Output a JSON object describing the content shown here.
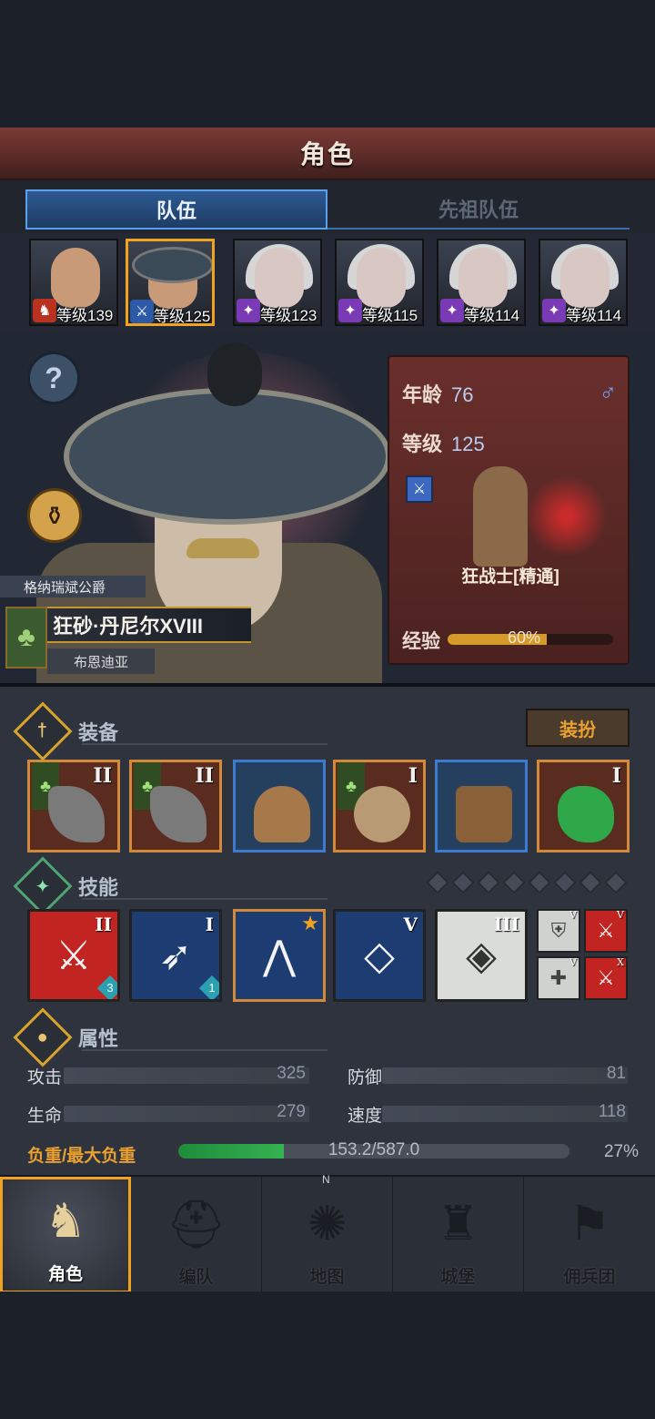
{
  "header": {
    "title": "角色"
  },
  "tabs": [
    {
      "label": "队伍",
      "active": true
    },
    {
      "label": "先祖队伍",
      "active": false
    }
  ],
  "roster": [
    {
      "level_text": "等级139",
      "badge_icon": "horse-icon"
    },
    {
      "level_text": "等级125",
      "badge_icon": "sword-icon",
      "selected": true
    },
    {
      "level_text": "等级123",
      "badge_icon": "staff-icon"
    },
    {
      "level_text": "等级115",
      "badge_icon": "staff-icon"
    },
    {
      "level_text": "等级114",
      "badge_icon": "staff-icon"
    },
    {
      "level_text": "等级114",
      "badge_icon": "staff-icon"
    }
  ],
  "character": {
    "noble_title": "格纳瑞斌公爵",
    "name": "狂砂·丹尼尔XVIII",
    "region": "布恩迪亚",
    "age_label": "年龄",
    "age": "76",
    "level_label": "等级",
    "level": "125",
    "gender_symbol": "♂",
    "class_name": "狂战士[精通]",
    "exp_label": "经验",
    "exp_text": "60%",
    "exp_fraction": 0.6
  },
  "equipment": {
    "title": "装备",
    "dress_button": "装扮",
    "slots": [
      {
        "tier": "II",
        "faction_flag": true,
        "item": "weapon"
      },
      {
        "tier": "II",
        "faction_flag": true,
        "item": "weapon"
      },
      {
        "tier": "",
        "faction_flag": false,
        "item": "helmet"
      },
      {
        "tier": "I",
        "faction_flag": true,
        "item": "armor"
      },
      {
        "tier": "",
        "faction_flag": false,
        "item": "boots"
      },
      {
        "tier": "I",
        "faction_flag": false,
        "item": "jade-charm"
      }
    ]
  },
  "skills": {
    "title": "技能",
    "slots": [
      {
        "tier": "II",
        "count": "3"
      },
      {
        "tier": "I",
        "count": "1"
      },
      {
        "tier": "",
        "starred": true
      },
      {
        "tier": "V"
      },
      {
        "tier": "III"
      }
    ],
    "mini": [
      {
        "tier": "V"
      },
      {
        "tier": "V"
      },
      {
        "tier": "V"
      },
      {
        "tier": "X"
      }
    ]
  },
  "attributes": {
    "title": "属性",
    "attack_label": "攻击",
    "attack": "325",
    "defense_label": "防御",
    "defense": "81",
    "hp_label": "生命",
    "hp": "279",
    "speed_label": "速度",
    "speed": "118",
    "load_label": "负重/最大负重",
    "load_text": "153.2/587.0",
    "load_pct": "27%",
    "load_fraction": 0.27
  },
  "nav": [
    {
      "label": "角色",
      "active": true
    },
    {
      "label": "编队"
    },
    {
      "label": "地图",
      "compass": "N"
    },
    {
      "label": "城堡"
    },
    {
      "label": "佣兵团"
    }
  ]
}
